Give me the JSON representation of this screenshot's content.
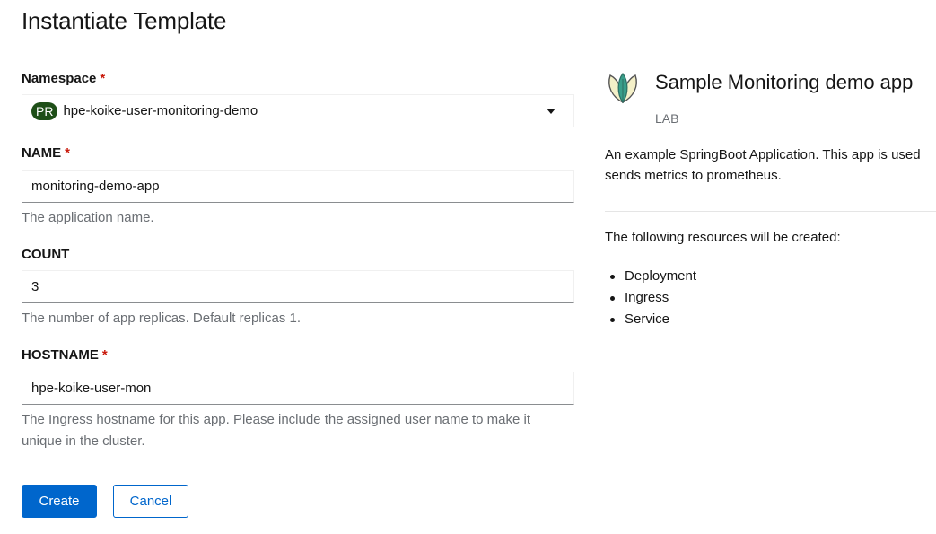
{
  "page": {
    "title": "Instantiate Template"
  },
  "form": {
    "namespace": {
      "label": "Namespace",
      "required_mark": "*",
      "badge": "PR",
      "value": "hpe-koike-user-monitoring-demo"
    },
    "name": {
      "label": "NAME",
      "required_mark": "*",
      "value": "monitoring-demo-app",
      "helper": "The application name."
    },
    "count": {
      "label": "COUNT",
      "value": "3",
      "helper": "The number of app replicas. Default replicas 1."
    },
    "hostname": {
      "label": "HOSTNAME",
      "required_mark": "*",
      "value": "hpe-koike-user-mon",
      "helper": "The Ingress hostname for this app. Please include the assigned user name to make it unique in the cluster."
    },
    "buttons": {
      "create": "Create",
      "cancel": "Cancel"
    }
  },
  "template_info": {
    "icon": "sprout-icon",
    "title": "Sample Monitoring demo app",
    "provider": "LAB",
    "description": "An example SpringBoot Application. This app is used sends metrics to prometheus.",
    "resources_intro": "The following resources will be created:",
    "resources": [
      "Deployment",
      "Ingress",
      "Service"
    ]
  },
  "colors": {
    "primary": "#0066cc",
    "required": "#c9190b",
    "badge_bg": "#1e4f18",
    "helper_text": "#6a6e73"
  }
}
